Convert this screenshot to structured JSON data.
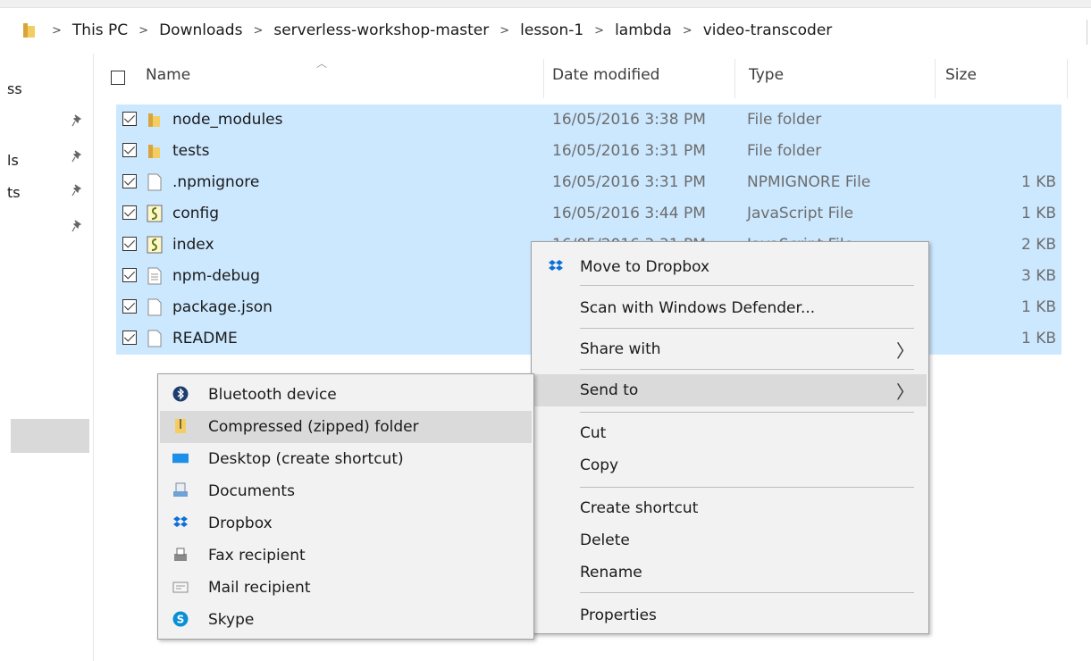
{
  "breadcrumb": {
    "items": [
      "This PC",
      "Downloads",
      "serverless-workshop-master",
      "lesson-1",
      "lambda",
      "video-transcoder"
    ],
    "separator": ">"
  },
  "nav": {
    "items": [
      "ss",
      "ls",
      "ts"
    ]
  },
  "columns": {
    "name": "Name",
    "date": "Date modified",
    "type": "Type",
    "size": "Size"
  },
  "files": [
    {
      "name": "node_modules",
      "date": "16/05/2016 3:38 PM",
      "type": "File folder",
      "size": "",
      "icon": "folder-icon"
    },
    {
      "name": "tests",
      "date": "16/05/2016 3:31 PM",
      "type": "File folder",
      "size": "",
      "icon": "folder-icon"
    },
    {
      "name": ".npmignore",
      "date": "16/05/2016 3:31 PM",
      "type": "NPMIGNORE File",
      "size": "1 KB",
      "icon": "file-icon"
    },
    {
      "name": "config",
      "date": "16/05/2016 3:44 PM",
      "type": "JavaScript File",
      "size": "1 KB",
      "icon": "js-file-icon"
    },
    {
      "name": "index",
      "date": "16/05/2016 3:31 PM",
      "type": "JavaScript File",
      "size": "2 KB",
      "icon": "js-file-icon"
    },
    {
      "name": "npm-debug",
      "date": "",
      "type": "",
      "size": "3 KB",
      "icon": "text-file-icon"
    },
    {
      "name": "package.json",
      "date": "",
      "type": "",
      "size": "1 KB",
      "icon": "file-icon"
    },
    {
      "name": "README",
      "date": "",
      "type": "",
      "size": "1 KB",
      "icon": "file-icon"
    }
  ],
  "context_menu": {
    "move_to_dropbox": "Move to Dropbox",
    "scan_defender": "Scan with Windows Defender...",
    "share_with": "Share with",
    "send_to": "Send to",
    "cut": "Cut",
    "copy": "Copy",
    "create_shortcut": "Create shortcut",
    "delete": "Delete",
    "rename": "Rename",
    "properties": "Properties"
  },
  "send_to_menu": {
    "bluetooth": "Bluetooth device",
    "zip": "Compressed (zipped) folder",
    "desktop": "Desktop (create shortcut)",
    "documents": "Documents",
    "dropbox": "Dropbox",
    "fax": "Fax recipient",
    "mail": "Mail recipient",
    "skype": "Skype"
  },
  "colors": {
    "selection": "#cce8ff",
    "menu_bg": "#f2f2f2",
    "menu_highlight": "#dadada",
    "folder": "#e8b84a",
    "dropbox": "#0d6fd8"
  }
}
